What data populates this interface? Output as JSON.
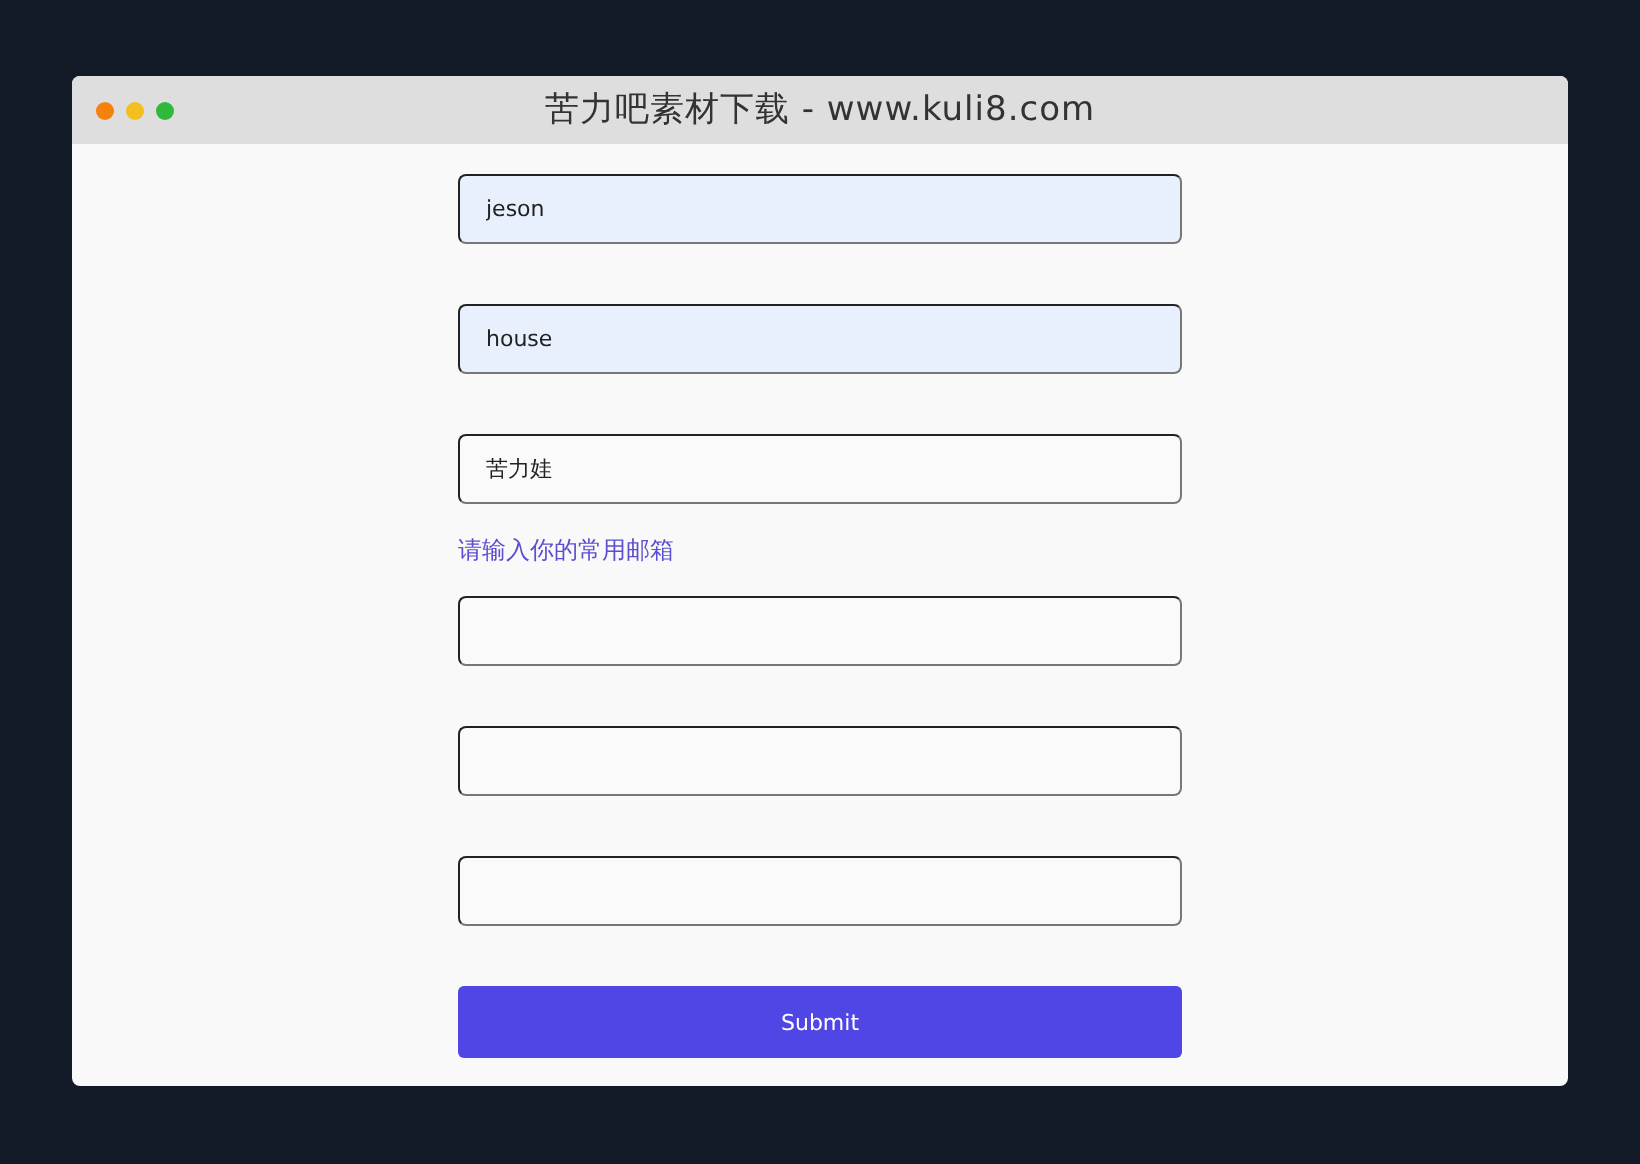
{
  "window": {
    "title": "苦力吧素材下载 - www.kuli8.com"
  },
  "form": {
    "items": [
      {
        "kind": "field",
        "value": "jeson",
        "autofilled": true
      },
      {
        "kind": "field",
        "value": "house",
        "autofilled": true
      },
      {
        "kind": "field",
        "value": "苦力娃",
        "autofilled": false
      },
      {
        "kind": "hint",
        "text": "请输入你的常用邮箱"
      },
      {
        "kind": "field",
        "autofilled": false
      },
      {
        "kind": "field",
        "autofilled": false
      },
      {
        "kind": "field",
        "autofilled": false
      },
      {
        "kind": "button",
        "label": "Submit"
      }
    ]
  }
}
